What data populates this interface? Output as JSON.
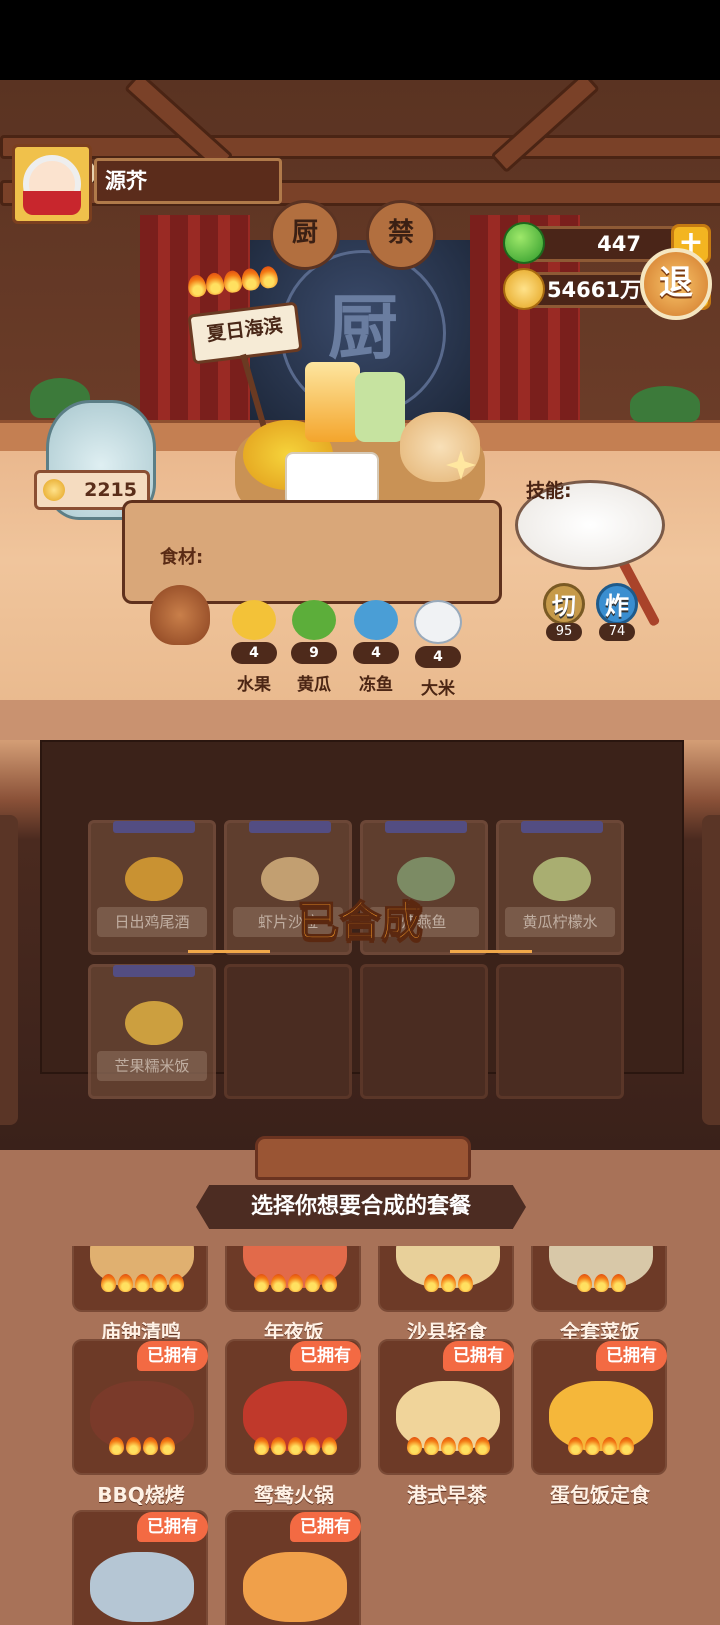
{
  "player": {
    "name": "源芥"
  },
  "resources": {
    "gems": "447",
    "coins": "54661万"
  },
  "buttons": {
    "exit": "退",
    "plus": "+"
  },
  "stage_sign": {
    "chars": [
      "厨",
      "禁"
    ],
    "logo": "厨"
  },
  "dish": {
    "name": "夏日海滨",
    "stars": 5
  },
  "jar": {
    "coins": "2215"
  },
  "ingredients": {
    "label": "食材:",
    "items": [
      {
        "name": "水果",
        "count": "4",
        "color": "#f3c238"
      },
      {
        "name": "黄瓜",
        "count": "9",
        "color": "#5cae3a"
      },
      {
        "name": "冻鱼",
        "count": "4",
        "color": "#4a9ed6"
      },
      {
        "name": "大米",
        "count": "4",
        "color": "#f0f2f4"
      }
    ]
  },
  "skills": {
    "label": "技能:",
    "items": [
      {
        "name": "切",
        "value": "95",
        "color": "#c69a4a"
      },
      {
        "name": "炸",
        "value": "74",
        "color": "#3a8ed0"
      }
    ]
  },
  "crafted": {
    "status": "已合成",
    "slots": [
      {
        "label": "日出鸡尾酒",
        "filled": true,
        "color": "#f2b23a"
      },
      {
        "label": "虾片沙拉",
        "filled": true,
        "color": "#e9c28a"
      },
      {
        "label": "烤燕鱼",
        "filled": true,
        "color": "#8fa97a"
      },
      {
        "label": "黄瓜柠檬水",
        "filled": true,
        "color": "#c8d68a"
      },
      {
        "label": "芒果糯米饭",
        "filled": true,
        "color": "#f5c24a"
      },
      {
        "label": "",
        "filled": false
      },
      {
        "label": "",
        "filled": false
      },
      {
        "label": "",
        "filled": false
      }
    ]
  },
  "selection": {
    "title": "选择你想要合成的套餐",
    "owned_label": "已拥有",
    "menus": [
      {
        "name": "庙钟清鸣",
        "owned": false,
        "flames": 5,
        "color": "#e0b070"
      },
      {
        "name": "年夜饭",
        "owned": false,
        "flames": 5,
        "color": "#e26a4a"
      },
      {
        "name": "沙县轻食",
        "owned": false,
        "flames": 3,
        "color": "#e8d09a"
      },
      {
        "name": "全套菜饭",
        "owned": false,
        "flames": 3,
        "color": "#d8c8a8"
      },
      {
        "name": "BBQ烧烤",
        "owned": true,
        "flames": 4,
        "color": "#7a3a2a"
      },
      {
        "name": "鸳鸯火锅",
        "owned": true,
        "flames": 5,
        "color": "#c0392b"
      },
      {
        "name": "港式早茶",
        "owned": true,
        "flames": 5,
        "color": "#f0d49a"
      },
      {
        "name": "蛋包饭定食",
        "owned": true,
        "flames": 4,
        "color": "#f5b73a"
      },
      {
        "name": "",
        "owned": true,
        "flames": 0,
        "color": "#b5c6d4"
      },
      {
        "name": "",
        "owned": true,
        "flames": 0,
        "color": "#f0a04a"
      }
    ]
  }
}
